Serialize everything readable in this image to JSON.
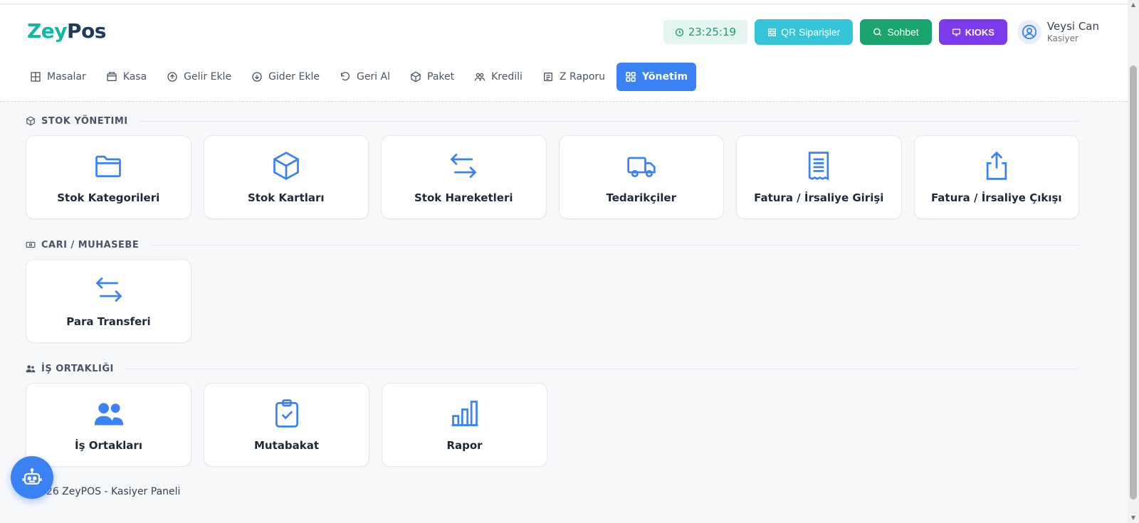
{
  "brand": {
    "part1": "Zey",
    "part2": "Pos"
  },
  "header": {
    "clock": "23:25:19",
    "qr_label": "QR Siparişler",
    "chat_label": "Sohbet",
    "kiosk_label": "KIOKS",
    "user_name": "Veysi Can",
    "user_role": "Kasiyer"
  },
  "nav": {
    "items": [
      {
        "label": "Masalar",
        "icon": "grid-icon"
      },
      {
        "label": "Kasa",
        "icon": "cash-register-icon"
      },
      {
        "label": "Gelir Ekle",
        "icon": "arrow-up-circle-icon"
      },
      {
        "label": "Gider Ekle",
        "icon": "arrow-down-circle-icon"
      },
      {
        "label": "Geri Al",
        "icon": "undo-icon"
      },
      {
        "label": "Paket",
        "icon": "package-icon"
      },
      {
        "label": "Kredili",
        "icon": "users-icon"
      },
      {
        "label": "Z Raporu",
        "icon": "receipt-icon"
      },
      {
        "label": "Yönetim",
        "icon": "dashboard-icon",
        "active": true
      }
    ]
  },
  "sections": [
    {
      "title": "STOK YÖNETIMI",
      "cards": [
        {
          "label": "Stok Kategorileri",
          "icon": "folder-icon"
        },
        {
          "label": "Stok Kartları",
          "icon": "box-icon"
        },
        {
          "label": "Stok Hareketleri",
          "icon": "transfer-arrows-icon"
        },
        {
          "label": "Tedarikçiler",
          "icon": "truck-icon"
        },
        {
          "label": "Fatura / İrsaliye Girişi",
          "icon": "invoice-icon"
        },
        {
          "label": "Fatura / İrsaliye Çıkışı",
          "icon": "share-upload-icon"
        }
      ]
    },
    {
      "title": "CARI / MUHASEBE",
      "cards": [
        {
          "label": "Para Transferi",
          "icon": "transfer-arrows-icon"
        }
      ]
    },
    {
      "title": "İŞ ORTAKLIĞI",
      "cards": [
        {
          "label": "İş Ortakları",
          "icon": "people-icon"
        },
        {
          "label": "Mutabakat",
          "icon": "clipboard-check-icon"
        },
        {
          "label": "Rapor",
          "icon": "bar-chart-icon"
        }
      ]
    }
  ],
  "footer": {
    "text": "026 ZeyPOS - Kasiyer Paneli"
  },
  "colors": {
    "accent": "#3b82f6",
    "brand_teal": "#10b9a0",
    "kiosk": "#7c3aed",
    "chat": "#1aa46e",
    "qr": "#36c5d8"
  }
}
